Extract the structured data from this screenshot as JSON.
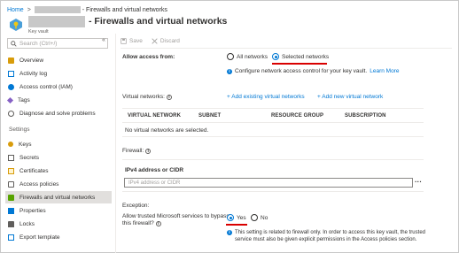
{
  "breadcrumb": {
    "home": "Home",
    "current": "- Firewalls and virtual networks"
  },
  "header": {
    "title": "- Firewalls and virtual networks",
    "subtitle": "Key vault"
  },
  "sidebar": {
    "search_placeholder": "Search (Ctrl+/)",
    "collapse_glyph": "«",
    "items": [
      {
        "label": "Overview",
        "icon": "key-vault-icon",
        "color": "#d89c0b"
      },
      {
        "label": "Activity log",
        "icon": "activity-log-icon",
        "color": "#0078d4"
      },
      {
        "label": "Access control (IAM)",
        "icon": "users-icon",
        "color": "#0078d4"
      },
      {
        "label": "Tags",
        "icon": "tag-icon",
        "color": "#8661c5"
      },
      {
        "label": "Diagnose and solve problems",
        "icon": "wrench-icon",
        "color": "#605e5c"
      }
    ],
    "settings_label": "Settings",
    "settings_items": [
      {
        "label": "Keys",
        "icon": "key-icon",
        "color": "#d89c0b"
      },
      {
        "label": "Secrets",
        "icon": "secret-icon",
        "color": "#605e5c"
      },
      {
        "label": "Certificates",
        "icon": "certificate-icon",
        "color": "#d89c0b"
      },
      {
        "label": "Access policies",
        "icon": "access-policy-icon",
        "color": "#605e5c"
      },
      {
        "label": "Firewalls and virtual networks",
        "icon": "network-icon",
        "color": "#57a300",
        "active": true
      },
      {
        "label": "Properties",
        "icon": "properties-icon",
        "color": "#0078d4"
      },
      {
        "label": "Locks",
        "icon": "lock-icon",
        "color": "#605e5c"
      },
      {
        "label": "Export template",
        "icon": "export-template-icon",
        "color": "#0078d4"
      }
    ]
  },
  "toolbar": {
    "save": "Save",
    "discard": "Discard"
  },
  "access": {
    "label": "Allow access from:",
    "option_all": "All networks",
    "option_selected": "Selected networks",
    "selected": "Selected networks",
    "info": "Configure network access control for your key vault.",
    "learn_more": "Learn More"
  },
  "vnet": {
    "label": "Virtual networks:",
    "add_existing": "+ Add existing virtual networks",
    "add_new": "+ Add new virtual network",
    "columns": [
      "VIRTUAL NETWORK",
      "SUBNET",
      "RESOURCE GROUP",
      "SUBSCRIPTION"
    ],
    "empty": "No virtual networks are selected."
  },
  "firewall": {
    "label": "Firewall:",
    "ip_label": "IPv4 address or CIDR",
    "ip_placeholder": "IPv4 address or CIDR",
    "more": "···"
  },
  "exception": {
    "label": "Exception:",
    "question_line1": "Allow trusted Microsoft services to bypass",
    "question_line2": "this firewall?",
    "yes": "Yes",
    "no": "No",
    "selected": "Yes",
    "note_line1": "This setting is related to firewall only. In order to access this key vault, the trusted",
    "note_line2": "service must also be given explicit permissions in the Access policies section."
  },
  "colors": {
    "accent": "#0078d4",
    "highlight": "#d90000"
  }
}
